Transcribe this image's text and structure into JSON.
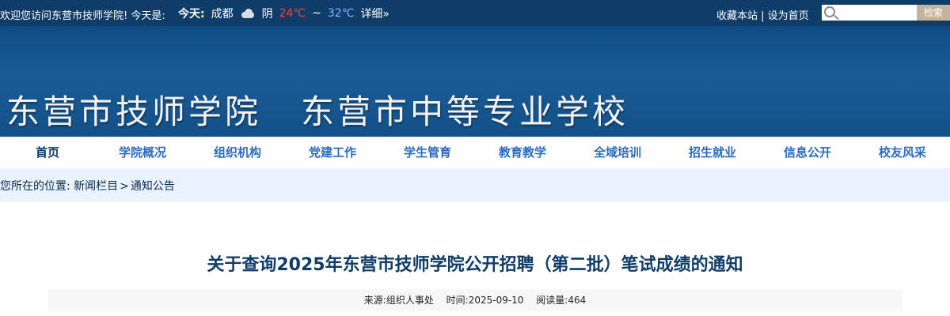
{
  "topbar": {
    "welcome": "欢迎您访问东营市技师学院!  今天是:",
    "today_label": "今天:",
    "city": "成都",
    "weather": "阴",
    "temp_high": "24℃",
    "tilde": "~",
    "temp_low": "32℃",
    "detail": "详细»",
    "favorite": "收藏本站",
    "set_home": "设为首页",
    "search_placeholder": "",
    "search_button": "检索"
  },
  "banner": {
    "title1": "东营市技师学院",
    "title2": "东营市中等专业学校"
  },
  "nav": {
    "items": [
      {
        "label": "首页"
      },
      {
        "label": "学院概况"
      },
      {
        "label": "组织机构"
      },
      {
        "label": "党建工作"
      },
      {
        "label": "学生管育"
      },
      {
        "label": "教育教学"
      },
      {
        "label": "全域培训"
      },
      {
        "label": "招生就业"
      },
      {
        "label": "信息公开"
      },
      {
        "label": "校友风采"
      }
    ]
  },
  "breadcrumb": {
    "label": "您所在的位置:",
    "level1": "新闻栏目",
    "sep": ">",
    "level2": "通知公告"
  },
  "article": {
    "title": "关于查询2025年东营市技师学院公开招聘（第二批）笔试成绩的通知",
    "source_label": "来源:",
    "source": "组织人事处",
    "time_label": "时间:",
    "time": "2025-09-10",
    "views_label": "阅读量:",
    "views": "464"
  },
  "colors": {
    "topbar_bg": "#0f3c68",
    "banner_bg": "#1b5b95",
    "nav_text": "#2b6cc2",
    "breadcrumb_bg": "#e9f2ff",
    "accent_temp_high": "#ff3a3a",
    "accent_temp_low": "#7fb8ff"
  },
  "icons": {
    "weather": "cloud-icon",
    "search": "search-icon"
  }
}
